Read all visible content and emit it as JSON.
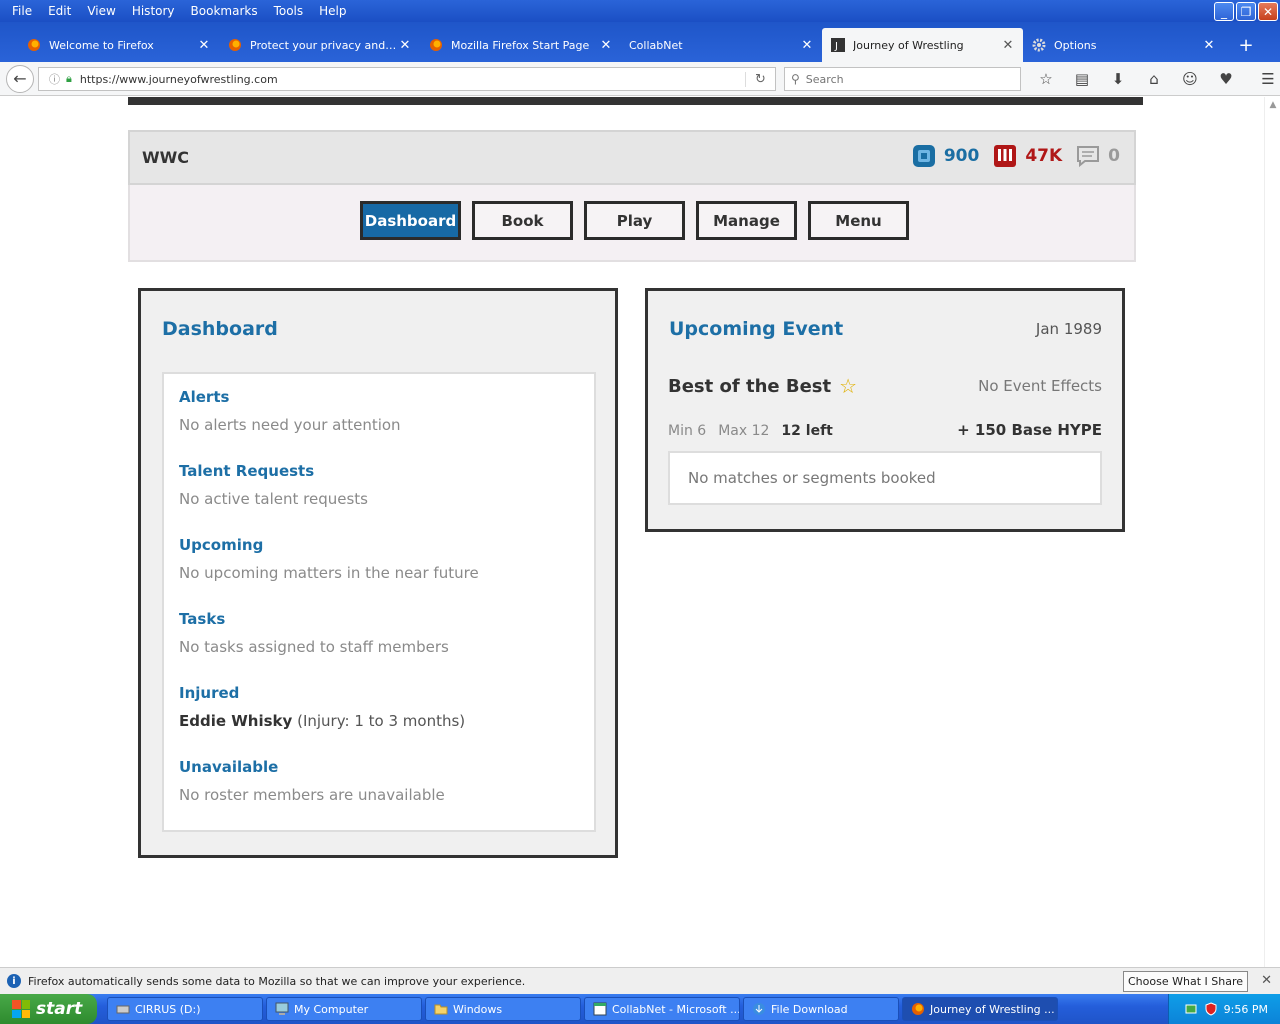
{
  "browser": {
    "menu": [
      "File",
      "Edit",
      "View",
      "History",
      "Bookmarks",
      "Tools",
      "Help"
    ],
    "tabs": [
      {
        "label": "Welcome to Firefox",
        "icon": "firefox-icon",
        "active": false
      },
      {
        "label": "Protect your privacy and br...",
        "icon": "firefox-icon",
        "active": false
      },
      {
        "label": "Mozilla Firefox Start Page",
        "icon": "firefox-icon",
        "active": false
      },
      {
        "label": "CollabNet",
        "icon": "",
        "active": false
      },
      {
        "label": "Journey of Wrestling",
        "icon": "j-icon",
        "active": true
      },
      {
        "label": "Options",
        "icon": "gear-icon",
        "active": false
      }
    ],
    "url": "https://www.journeyofwrestling.com",
    "search_placeholder": "Search"
  },
  "header": {
    "company": "WWC",
    "stats": {
      "hype": "900",
      "money": "47K",
      "messages": "0"
    }
  },
  "nav": {
    "dashboard": "Dashboard",
    "book": "Book",
    "play": "Play",
    "manage": "Manage",
    "menu": "Menu"
  },
  "dashboard": {
    "title": "Dashboard",
    "items": [
      {
        "title": "Alerts",
        "text": "No alerts need your attention"
      },
      {
        "title": "Talent Requests",
        "text": "No active talent requests"
      },
      {
        "title": "Upcoming",
        "text": "No upcoming matters in the near future"
      },
      {
        "title": "Tasks",
        "text": "No tasks assigned to staff members"
      },
      {
        "title": "Injured",
        "name": "Eddie Whisky",
        "detail": "(Injury: 1 to 3 months)"
      },
      {
        "title": "Unavailable",
        "text": "No roster members are unavailable"
      }
    ]
  },
  "event": {
    "title": "Upcoming Event",
    "date": "Jan 1989",
    "name": "Best of the Best",
    "effects": "No Event Effects",
    "min": "Min 6",
    "max": "Max 12",
    "left": "12 left",
    "hype": "+ 150 Base HYPE",
    "empty": "No matches or segments booked"
  },
  "notification": {
    "message": "Firefox automatically sends some data to Mozilla so that we can improve your experience.",
    "button": "Choose What I Share"
  },
  "taskbar": {
    "start": "start",
    "tasks": [
      "CIRRUS (D:)",
      "My Computer",
      "Windows",
      "CollabNet - Microsoft ...",
      "File Download",
      "Journey of Wrestling ..."
    ],
    "time": "9:56 PM"
  },
  "colors": {
    "accent_blue": "#1d6fa6",
    "primary_button": "#1769a5",
    "money_red": "#b01717",
    "xp_blue": "#245edb"
  }
}
